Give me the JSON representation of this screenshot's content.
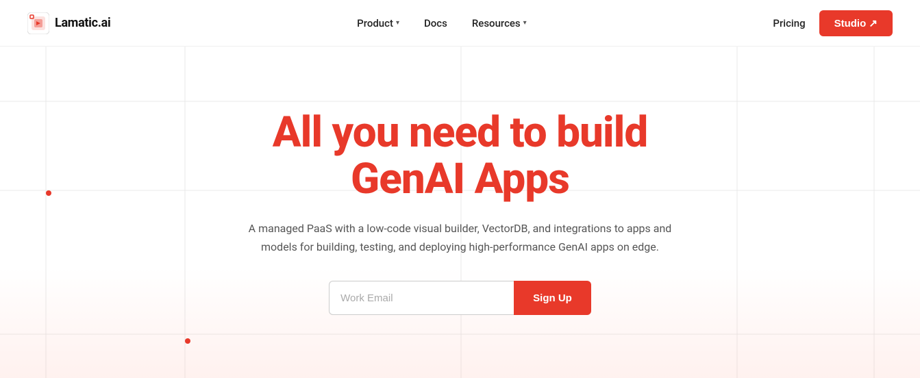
{
  "logo": {
    "text": "Lamatic.ai"
  },
  "navbar": {
    "product_label": "Product",
    "docs_label": "Docs",
    "resources_label": "Resources",
    "pricing_label": "Pricing",
    "studio_label": "Studio ↗"
  },
  "hero": {
    "title_line1": "All you need to build",
    "title_line2": "GenAI Apps",
    "subtitle": "A managed PaaS with a low-code visual builder, VectorDB, and integrations to apps and models for building, testing, and deploying high-performance GenAI apps on edge.",
    "email_placeholder": "Work Email",
    "signup_label": "Sign Up"
  },
  "colors": {
    "accent": "#e8392a",
    "text_dark": "#111111",
    "text_muted": "#555555"
  }
}
